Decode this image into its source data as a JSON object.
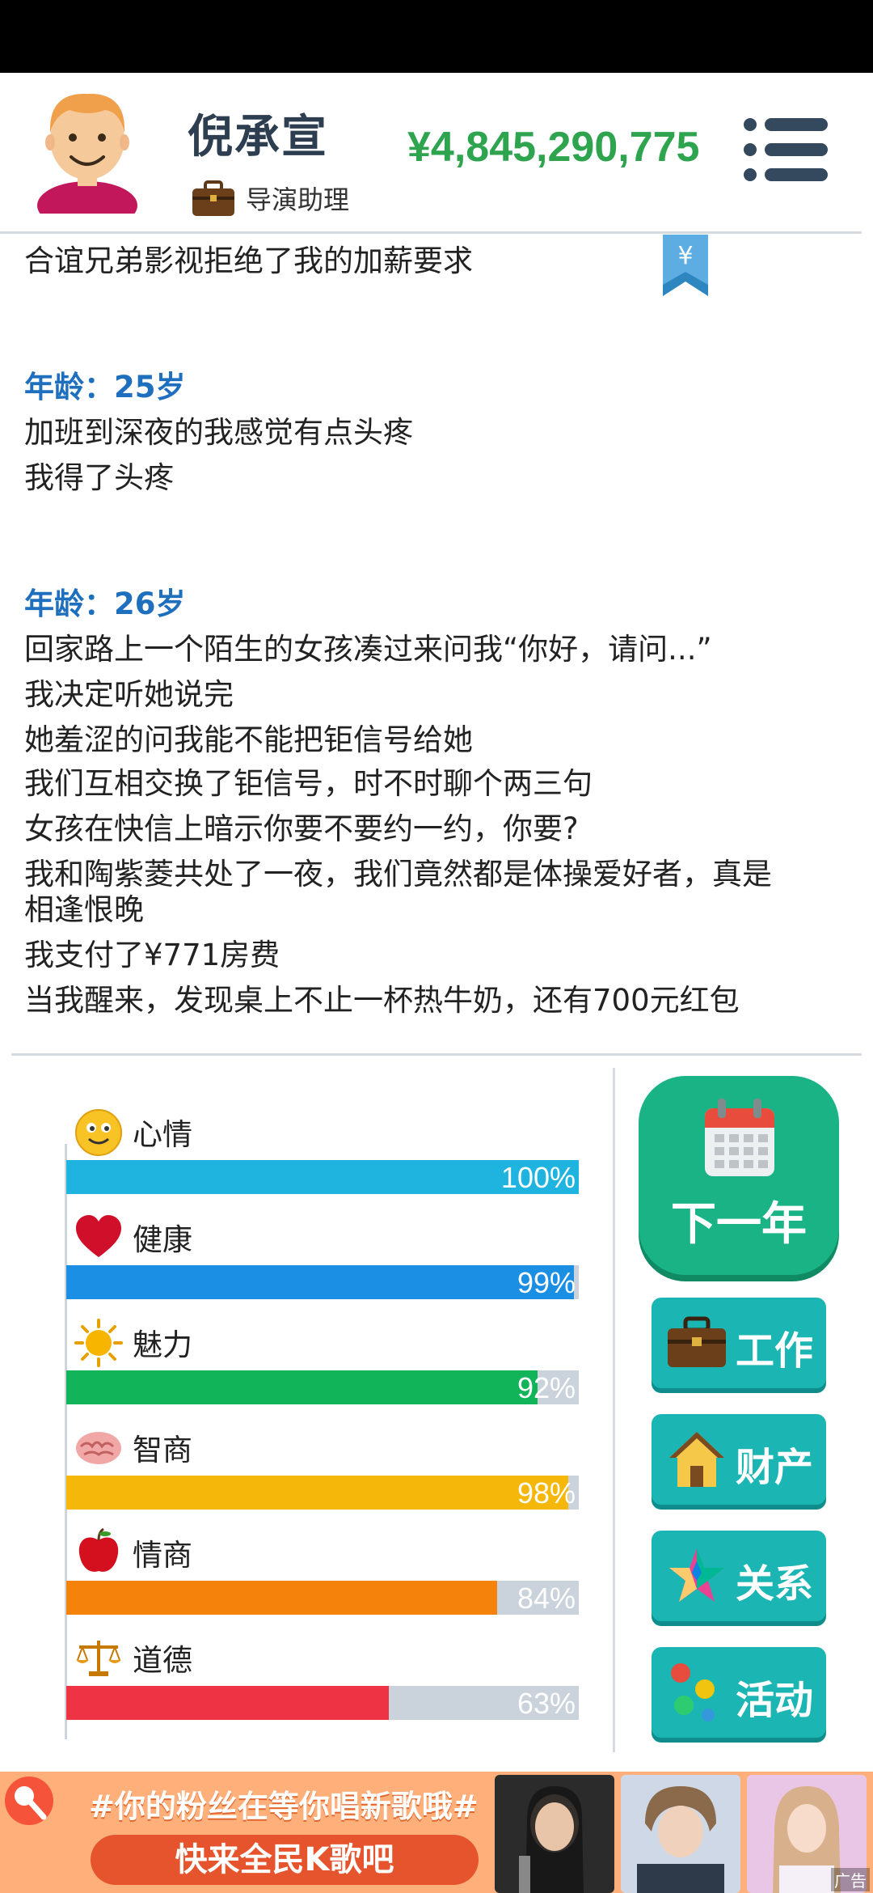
{
  "player": {
    "name": "倪承宣",
    "job": "导演助理",
    "money": "¥4,845,290,775"
  },
  "log": {
    "lines": [
      "合谊兄弟影视拒绝了我的加薪要求",
      "年龄：25岁",
      "加班到深夜的我感觉有点头疼",
      "我得了头疼",
      "年龄：26岁",
      "回家路上一个陌生的女孩凑过来问我“你好，请问...”",
      "我决定听她说完",
      "她羞涩的问我能不能把钜信号给她",
      "我们互相交换了钜信号，时不时聊个两三句",
      "女孩在快信上暗示你要不要约一约，你要?",
      "我和陶紫菱共处了一夜，我们竟然都是体操爱好者，真是",
      "相逢恨晚",
      "我支付了¥771房费",
      "当我醒来，发现桌上不止一杯热牛奶，还有700元红包"
    ]
  },
  "stats": [
    {
      "label": "心情",
      "value": 100,
      "text": "100%",
      "color": "#1fb3e0",
      "icon": "smiley-icon"
    },
    {
      "label": "健康",
      "value": 99,
      "text": "99%",
      "color": "#1a8fe3",
      "icon": "heart-icon"
    },
    {
      "label": "魅力",
      "value": 92,
      "text": "92%",
      "color": "#12b45a",
      "icon": "sun-icon"
    },
    {
      "label": "智商",
      "value": 98,
      "text": "98%",
      "color": "#f5b80a",
      "icon": "brain-icon"
    },
    {
      "label": "情商",
      "value": 84,
      "text": "84%",
      "color": "#f5820a",
      "icon": "apple-icon"
    },
    {
      "label": "道德",
      "value": 63,
      "text": "63%",
      "color": "#ee3344",
      "icon": "scales-icon"
    }
  ],
  "buttons": {
    "next_year": "下一年",
    "work": "工作",
    "property": "财产",
    "relations": "关系",
    "activity": "活动"
  },
  "ad": {
    "headline": "#你的粉丝在等你唱新歌哦#",
    "cta": "快来全民K歌吧",
    "tag": "广告"
  }
}
